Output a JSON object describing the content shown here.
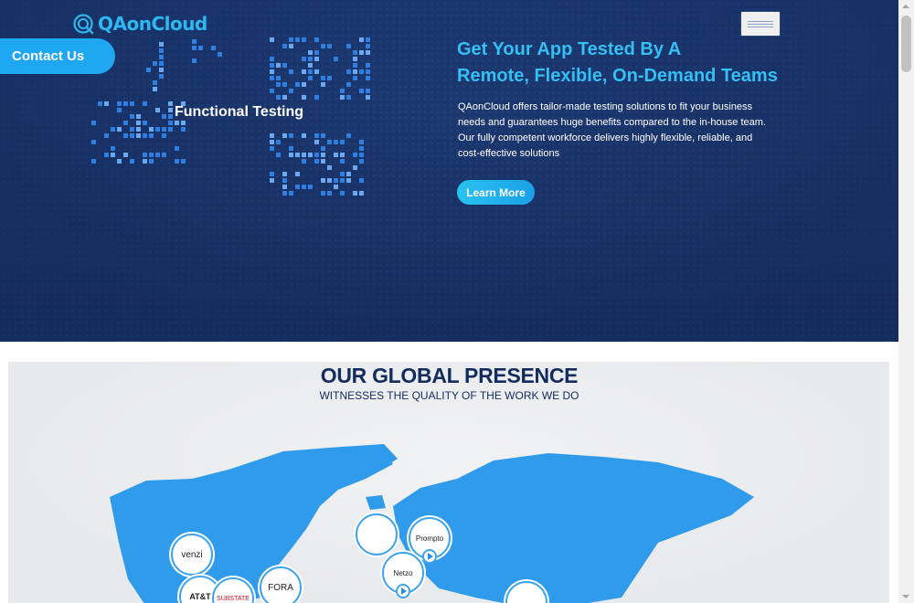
{
  "brand": {
    "name": "QAonCloud",
    "accent": "#2fb7ef"
  },
  "nav": {
    "contact_label": "Contact Us",
    "menu_icon": "hamburger-icon"
  },
  "hero": {
    "feature_label": "Functional Testing",
    "title_line1": "Get Your App Tested By A",
    "title_line2": "Remote, Flexible, On-Demand Teams",
    "description_line1": "QAonCloud offers tailor-made testing solutions to fit your business",
    "description_line2": "needs and guarantees huge benefits compared to the in-house team.",
    "description_line3": "Our fully competent workforce delivers highly flexible, reliable, and",
    "description_line4": "cost-effective solutions",
    "cta_label": "Learn More",
    "background_color": "#1b366c"
  },
  "global": {
    "title": "OUR GLOBAL PRESENCE",
    "subtitle": "WITNESSES THE QUALITY OF THE WORK WE DO",
    "map_color": "#2f9bea",
    "clients": [
      {
        "name": "venzi"
      },
      {
        "name": "AT&T"
      },
      {
        "name": "SUBSTATE"
      },
      {
        "name": "FORA"
      },
      {
        "name": "Prompto"
      },
      {
        "name": "Netzo"
      }
    ]
  }
}
